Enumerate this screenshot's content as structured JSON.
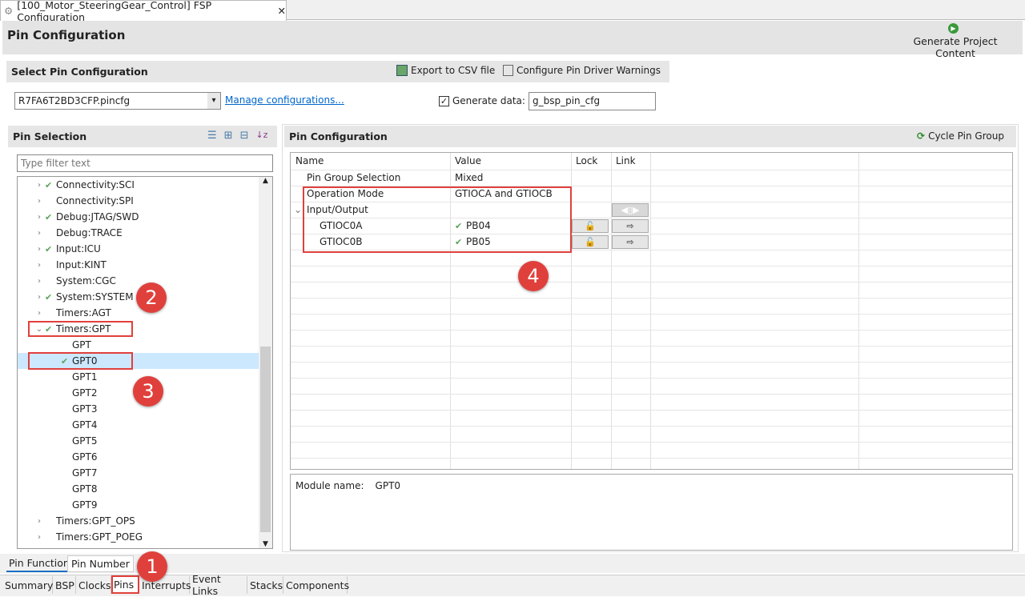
{
  "editor_tab": {
    "title": "[100_Motor_SteeringGear_Control] FSP Configuration",
    "icon": "gear-icon"
  },
  "header": {
    "title": "Pin Configuration",
    "generate_label": "Generate Project Content"
  },
  "select_config": {
    "title": "Select Pin Configuration",
    "export_label": "Export to CSV file",
    "warnings_label": "Configure Pin Driver Warnings",
    "config_value": "R7FA6T2BD3CFP.pincfg",
    "manage_link": "Manage configurations...",
    "generate_data_label": "Generate data:",
    "generate_data_checked": true,
    "generate_data_value": "g_bsp_pin_cfg"
  },
  "pin_selection": {
    "title": "Pin Selection",
    "filter_placeholder": "Type filter text",
    "items": [
      {
        "label": "Connectivity:SCI",
        "level": 0,
        "expander": "collapsed",
        "checked": true
      },
      {
        "label": "Connectivity:SPI",
        "level": 0,
        "expander": "collapsed",
        "checked": false
      },
      {
        "label": "Debug:JTAG/SWD",
        "level": 0,
        "expander": "collapsed",
        "checked": true
      },
      {
        "label": "Debug:TRACE",
        "level": 0,
        "expander": "collapsed",
        "checked": false
      },
      {
        "label": "Input:ICU",
        "level": 0,
        "expander": "collapsed",
        "checked": true
      },
      {
        "label": "Input:KINT",
        "level": 0,
        "expander": "collapsed",
        "checked": false
      },
      {
        "label": "System:CGC",
        "level": 0,
        "expander": "collapsed",
        "checked": false
      },
      {
        "label": "System:SYSTEM",
        "level": 0,
        "expander": "collapsed",
        "checked": true
      },
      {
        "label": "Timers:AGT",
        "level": 0,
        "expander": "collapsed",
        "checked": false
      },
      {
        "label": "Timers:GPT",
        "level": 0,
        "expander": "expanded",
        "checked": true
      },
      {
        "label": "GPT",
        "level": 1,
        "checked": false
      },
      {
        "label": "GPT0",
        "level": 1,
        "checked": true,
        "selected": true
      },
      {
        "label": "GPT1",
        "level": 1,
        "checked": false
      },
      {
        "label": "GPT2",
        "level": 1,
        "checked": false
      },
      {
        "label": "GPT3",
        "level": 1,
        "checked": false
      },
      {
        "label": "GPT4",
        "level": 1,
        "checked": false
      },
      {
        "label": "GPT5",
        "level": 1,
        "checked": false
      },
      {
        "label": "GPT6",
        "level": 1,
        "checked": false
      },
      {
        "label": "GPT7",
        "level": 1,
        "checked": false
      },
      {
        "label": "GPT8",
        "level": 1,
        "checked": false
      },
      {
        "label": "GPT9",
        "level": 1,
        "checked": false
      },
      {
        "label": "Timers:GPT_OPS",
        "level": 0,
        "expander": "collapsed",
        "checked": false
      },
      {
        "label": "Timers:GPT_POEG",
        "level": 0,
        "expander": "collapsed",
        "checked": false
      }
    ]
  },
  "pin_config": {
    "title": "Pin Configuration",
    "cycle_label": "Cycle Pin Group",
    "columns": [
      "Name",
      "Value",
      "Lock",
      "Link"
    ],
    "rows": [
      {
        "name": "Pin Group Selection",
        "value": "Mixed"
      },
      {
        "name": "Operation Mode",
        "value": "GTIOCA and GTIOCB"
      },
      {
        "name": "Input/Output",
        "value": "",
        "expander": "expanded"
      },
      {
        "name": "GTIOC0A",
        "value": "PB04",
        "checked": true,
        "lock": "unlocked"
      },
      {
        "name": "GTIOC0B",
        "value": "PB05",
        "checked": true,
        "lock": "unlocked"
      }
    ],
    "module_label": "Module name:",
    "module_value": "GPT0"
  },
  "view_tabs": [
    {
      "label": "Pin Function",
      "active": true
    },
    {
      "label": "Pin Number"
    }
  ],
  "bottom_tabs": [
    {
      "label": "Summary"
    },
    {
      "label": "BSP"
    },
    {
      "label": "Clocks"
    },
    {
      "label": "Pins",
      "active": true
    },
    {
      "label": "Interrupts"
    },
    {
      "label": "Event Links"
    },
    {
      "label": "Stacks"
    },
    {
      "label": "Components"
    }
  ],
  "annotations": [
    "1",
    "2",
    "3",
    "4"
  ],
  "colors": {
    "accent_red": "#e0403c",
    "check_green": "#5aa55a",
    "selection": "#cce8ff",
    "link": "#0066cc"
  }
}
